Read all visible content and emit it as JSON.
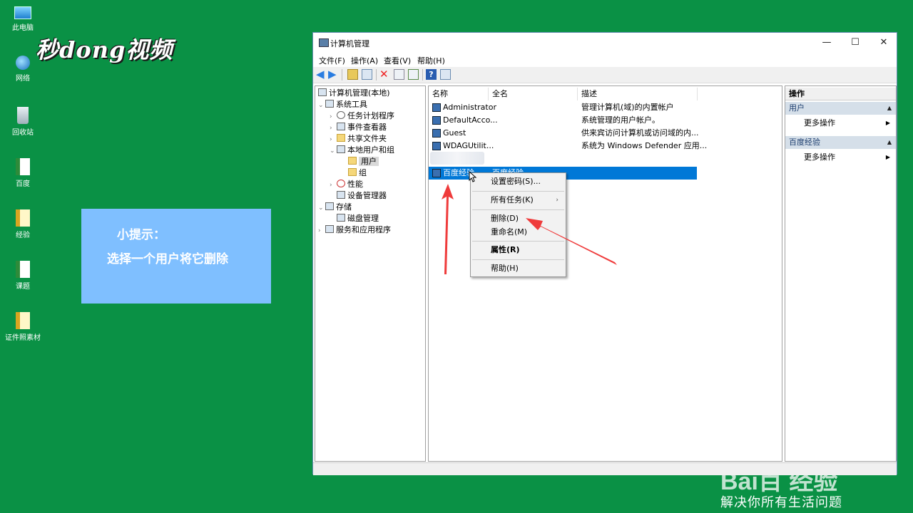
{
  "desktop": {
    "icons": [
      "此电脑",
      "网络",
      "回收站",
      "百度",
      "经验",
      "课题",
      "证件照素材"
    ],
    "brand": "秒dong视频",
    "tip": {
      "title": "小提示：",
      "body": "选择一个用户将它删除"
    },
    "watermark": "Bai百 经验",
    "slogan": "解决你所有生活问题"
  },
  "window": {
    "title": "计算机管理",
    "controls": {
      "minimize": "—",
      "maximize": "☐",
      "close": "✕"
    },
    "menu": [
      "文件(F)",
      "操作(A)",
      "查看(V)",
      "帮助(H)"
    ],
    "tree": [
      "计算机管理(本地)",
      "系统工具",
      "任务计划程序",
      "事件查看器",
      "共享文件夹",
      "本地用户和组",
      "用户",
      "组",
      "性能",
      "设备管理器",
      "存储",
      "磁盘管理",
      "服务和应用程序"
    ],
    "list": {
      "columns": [
        "名称",
        "全名",
        "描述"
      ],
      "rows": [
        {
          "name": "Administrator",
          "full": "",
          "desc": "管理计算机(域)的内置帐户"
        },
        {
          "name": "DefaultAcco...",
          "full": "",
          "desc": "系统管理的用户帐户。"
        },
        {
          "name": "Guest",
          "full": "",
          "desc": "供来宾访问计算机或访问域的内..."
        },
        {
          "name": "WDAGUtilit...",
          "full": "",
          "desc": "系统为 Windows Defender 应用..."
        },
        {
          "name": "百度经验",
          "full": "百度经验",
          "desc": ""
        }
      ]
    },
    "actions": {
      "header": "操作",
      "sections": [
        {
          "title": "用户",
          "item": "更多操作"
        },
        {
          "title": "百度经验",
          "item": "更多操作"
        }
      ]
    },
    "context_menu": [
      "设置密码(S)...",
      "所有任务(K)",
      "删除(D)",
      "重命名(M)",
      "属性(R)",
      "帮助(H)"
    ]
  },
  "colors": {
    "desktop": "#0a9145",
    "selection": "#0078d7",
    "tip": "#7fbfff",
    "arrow": "#ef3b3b"
  }
}
